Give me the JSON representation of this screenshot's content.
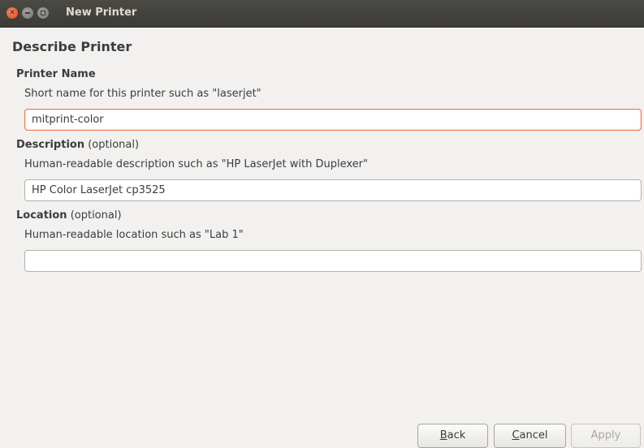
{
  "window": {
    "title": "New Printer"
  },
  "page": {
    "heading": "Describe Printer"
  },
  "printer_name": {
    "label": "Printer Name",
    "hint": "Short name for this printer such as \"laserjet\"",
    "value": "mitprint-color"
  },
  "description": {
    "label": "Description",
    "optional": " (optional)",
    "hint": "Human-readable description such as \"HP LaserJet with Duplexer\"",
    "value": "HP Color LaserJet cp3525"
  },
  "location": {
    "label": "Location",
    "optional": " (optional)",
    "hint": "Human-readable location such as \"Lab 1\"",
    "value": ""
  },
  "buttons": {
    "back": {
      "mnemonic": "B",
      "rest": "ack"
    },
    "cancel": {
      "mnemonic": "C",
      "rest": "ancel"
    },
    "apply": "Apply"
  },
  "colors": {
    "titlebar": "#3c3b37",
    "focus_border": "#f07746",
    "background": "#f2f1f0"
  }
}
